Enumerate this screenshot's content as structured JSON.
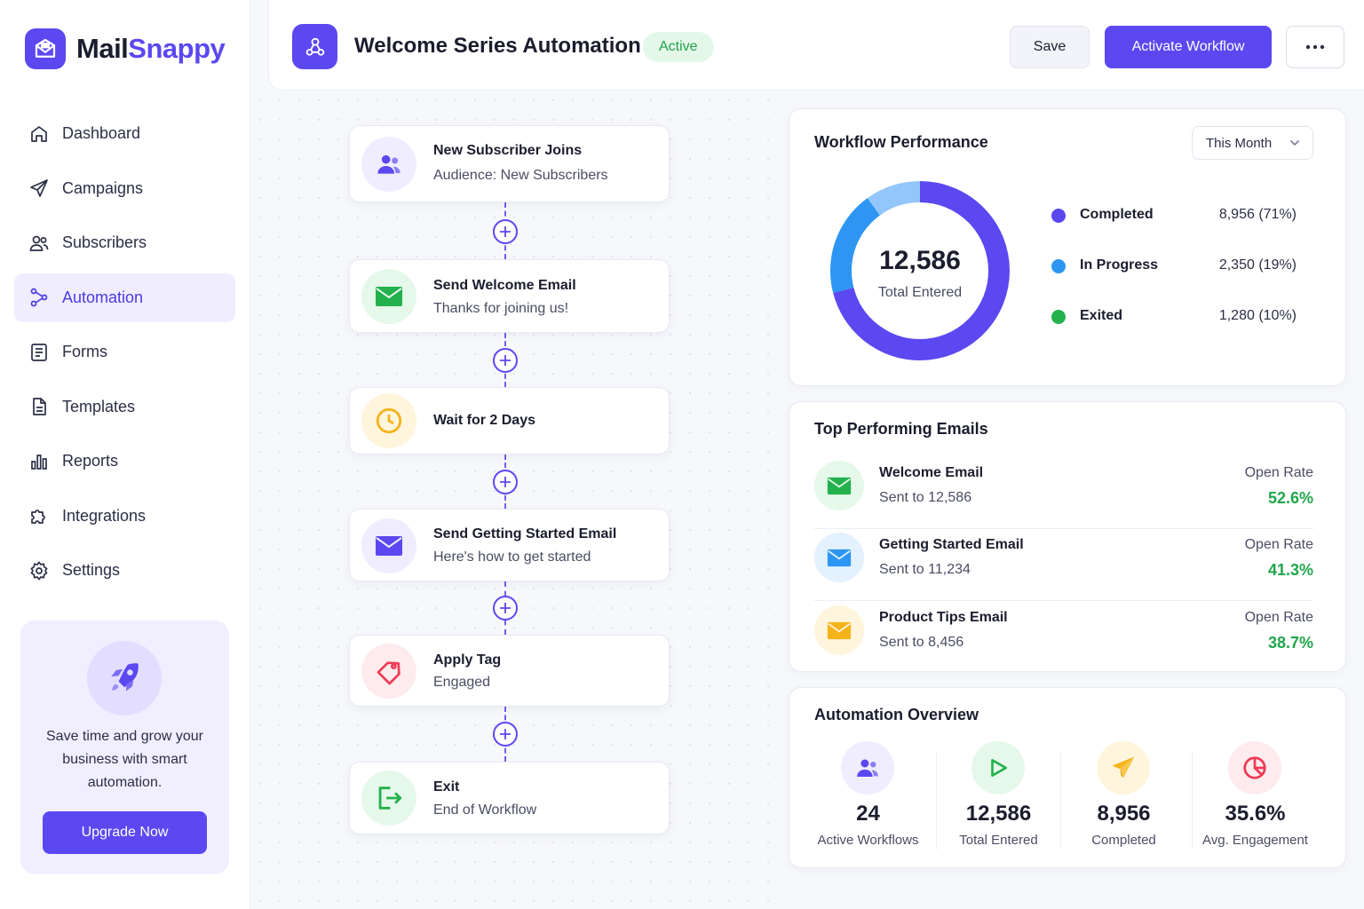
{
  "app": {
    "brand_part1": "Mail",
    "brand_part2": "Snappy"
  },
  "sidebar": {
    "items": [
      {
        "label": "Dashboard",
        "icon": "home-icon",
        "active": false
      },
      {
        "label": "Campaigns",
        "icon": "send-icon",
        "active": false
      },
      {
        "label": "Subscribers",
        "icon": "users-icon",
        "active": false
      },
      {
        "label": "Automation",
        "icon": "automation-icon",
        "active": true
      },
      {
        "label": "Forms",
        "icon": "form-icon",
        "active": false
      },
      {
        "label": "Templates",
        "icon": "template-icon",
        "active": false
      },
      {
        "label": "Reports",
        "icon": "bar-chart-icon",
        "active": false
      },
      {
        "label": "Integrations",
        "icon": "puzzle-icon",
        "active": false
      },
      {
        "label": "Settings",
        "icon": "gear-icon",
        "active": false
      }
    ],
    "promo": {
      "text": "Save time and grow your business with smart automation.",
      "button": "Upgrade Now",
      "icon": "rocket-icon"
    }
  },
  "header": {
    "title": "Welcome Series Automation",
    "status": "Active",
    "save_label": "Save",
    "activate_label": "Activate Workflow",
    "more_icon": "more-horizontal-icon"
  },
  "workflow": {
    "steps": [
      {
        "title": "New Subscriber Joins",
        "subtitle": "Audience: New Subscribers",
        "icon": "users-icon"
      },
      {
        "title": "Send Welcome Email",
        "subtitle": "Thanks for joining us!",
        "icon": "mail-icon"
      },
      {
        "title": "Wait for 2 Days",
        "subtitle": "",
        "icon": "clock-icon"
      },
      {
        "title": "Send Getting Started Email",
        "subtitle": "Here's how to get started",
        "icon": "mail-icon"
      },
      {
        "title": "Apply Tag",
        "subtitle": "Engaged",
        "icon": "tag-icon"
      },
      {
        "title": "Exit",
        "subtitle": "End of Workflow",
        "icon": "exit-icon"
      }
    ]
  },
  "performance": {
    "title": "Workflow Performance",
    "period": "This Month",
    "total_value": "12,586",
    "total_label": "Total Entered",
    "legend": [
      {
        "name": "Completed",
        "value": "8,956 (71%)",
        "color": "#5b48f0"
      },
      {
        "name": "In Progress",
        "value": "2,350 (19%)",
        "color": "#2d96f2"
      },
      {
        "name": "Exited",
        "value": "1,280 (10%)",
        "color": "#22b14c"
      }
    ]
  },
  "top_emails": {
    "title": "Top Performing Emails",
    "rate_label": "Open Rate",
    "items": [
      {
        "name": "Welcome Email",
        "sent": "Sent to 12,586",
        "rate": "52.6%",
        "color": "#22b14c"
      },
      {
        "name": "Getting Started Email",
        "sent": "Sent to 11,234",
        "rate": "41.3%",
        "color": "#2d96f2"
      },
      {
        "name": "Product Tips Email",
        "sent": "Sent to 8,456",
        "rate": "38.7%",
        "color": "#f5b31b"
      }
    ]
  },
  "overview": {
    "title": "Automation Overview",
    "stats": [
      {
        "value": "24",
        "label": "Active Workflows",
        "icon": "users-icon"
      },
      {
        "value": "12,586",
        "label": "Total Entered",
        "icon": "play-icon"
      },
      {
        "value": "8,956",
        "label": "Completed",
        "icon": "paper-plane-icon"
      },
      {
        "value": "35.6%",
        "label": "Avg. Engagement",
        "icon": "pie-chart-icon"
      }
    ]
  }
}
